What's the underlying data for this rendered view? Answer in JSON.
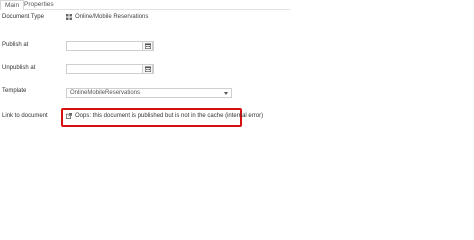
{
  "tabs": [
    {
      "label": "Main"
    },
    {
      "label": "Properties"
    }
  ],
  "fields": {
    "document_type": {
      "label": "Document Type",
      "value": "Online/Mobile Reservations"
    },
    "publish_at": {
      "label": "Publish at",
      "value": "",
      "placeholder": ""
    },
    "unpublish_at": {
      "label": "Unpublish at",
      "value": "",
      "placeholder": ""
    },
    "template": {
      "label": "Template",
      "value": "OnlineMobileReservations"
    },
    "link_to_document": {
      "label": "Link to document",
      "message": "Oops: this document is published but is not in the cache (internal error)"
    }
  },
  "colors": {
    "highlight": "#d60f0f"
  },
  "icons": {
    "document_type": "grid-icon",
    "calendar": "calendar-icon",
    "link": "external-link-icon"
  }
}
